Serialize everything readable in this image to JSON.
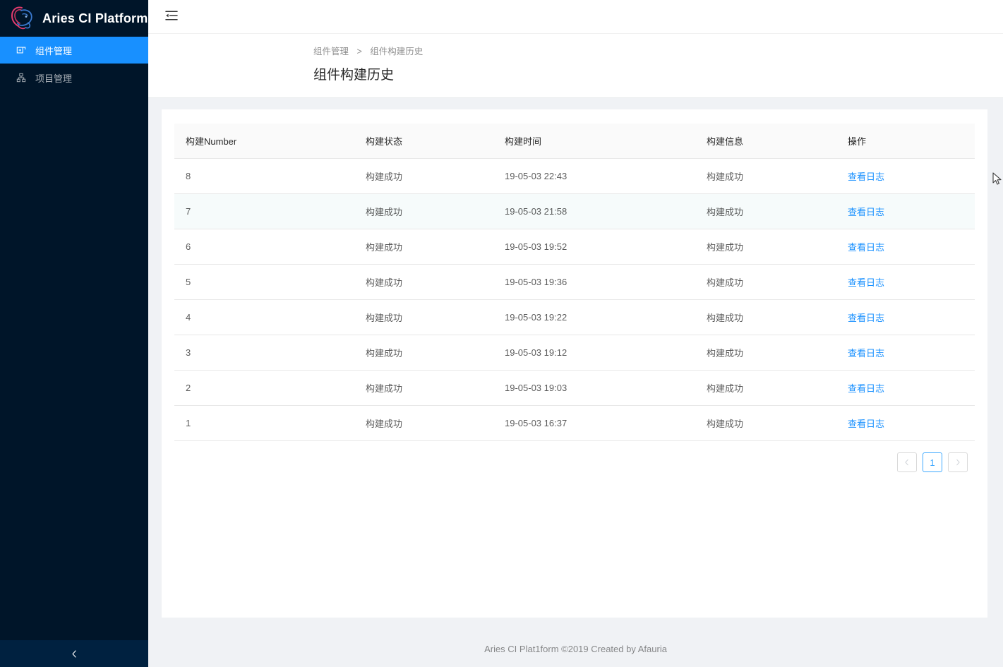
{
  "brand": {
    "name": "Aries CI Platform",
    "logo_icon": "aries-ram-head-logo",
    "logo_color_a": "#e23b6e",
    "logo_color_b": "#2d6fd6"
  },
  "sidebar": {
    "items": [
      {
        "label": "组件管理",
        "icon": "component-icon",
        "active": true
      },
      {
        "label": "项目管理",
        "icon": "project-icon",
        "active": false
      }
    ],
    "collapse_trigger_icon": "chevron-left-icon",
    "active_color": "#1890ff",
    "background_color": "#001529"
  },
  "topbar": {
    "fold_icon": "menu-fold-icon"
  },
  "pagehead": {
    "breadcrumb": {
      "parent": "组件管理",
      "separator": ">",
      "current": "组件构建历史"
    },
    "title": "组件构建历史"
  },
  "table": {
    "headers": [
      "构建Number",
      "构建状态",
      "构建时间",
      "构建信息",
      "操作"
    ],
    "action_label": "查看日志",
    "link_color": "#1890ff",
    "rows": [
      {
        "number": "8",
        "status": "构建成功",
        "time": "19-05-03 22:43",
        "info": "构建成功",
        "action": "查看日志",
        "hovered": false
      },
      {
        "number": "7",
        "status": "构建成功",
        "time": "19-05-03 21:58",
        "info": "构建成功",
        "action": "查看日志",
        "hovered": true
      },
      {
        "number": "6",
        "status": "构建成功",
        "time": "19-05-03 19:52",
        "info": "构建成功",
        "action": "查看日志",
        "hovered": false
      },
      {
        "number": "5",
        "status": "构建成功",
        "time": "19-05-03 19:36",
        "info": "构建成功",
        "action": "查看日志",
        "hovered": false
      },
      {
        "number": "4",
        "status": "构建成功",
        "time": "19-05-03 19:22",
        "info": "构建成功",
        "action": "查看日志",
        "hovered": false
      },
      {
        "number": "3",
        "status": "构建成功",
        "time": "19-05-03 19:12",
        "info": "构建成功",
        "action": "查看日志",
        "hovered": false
      },
      {
        "number": "2",
        "status": "构建成功",
        "time": "19-05-03 19:03",
        "info": "构建成功",
        "action": "查看日志",
        "hovered": false
      },
      {
        "number": "1",
        "status": "构建成功",
        "time": "19-05-03 16:37",
        "info": "构建成功",
        "action": "查看日志",
        "hovered": false
      }
    ]
  },
  "pagination": {
    "prev_icon": "chevron-left-icon",
    "next_icon": "chevron-right-icon",
    "pages": [
      "1"
    ],
    "current_page": "1",
    "prev_disabled": true,
    "next_disabled": true
  },
  "footer": {
    "text": "Aries CI Plat1form ©2019 Created by Afauria"
  }
}
